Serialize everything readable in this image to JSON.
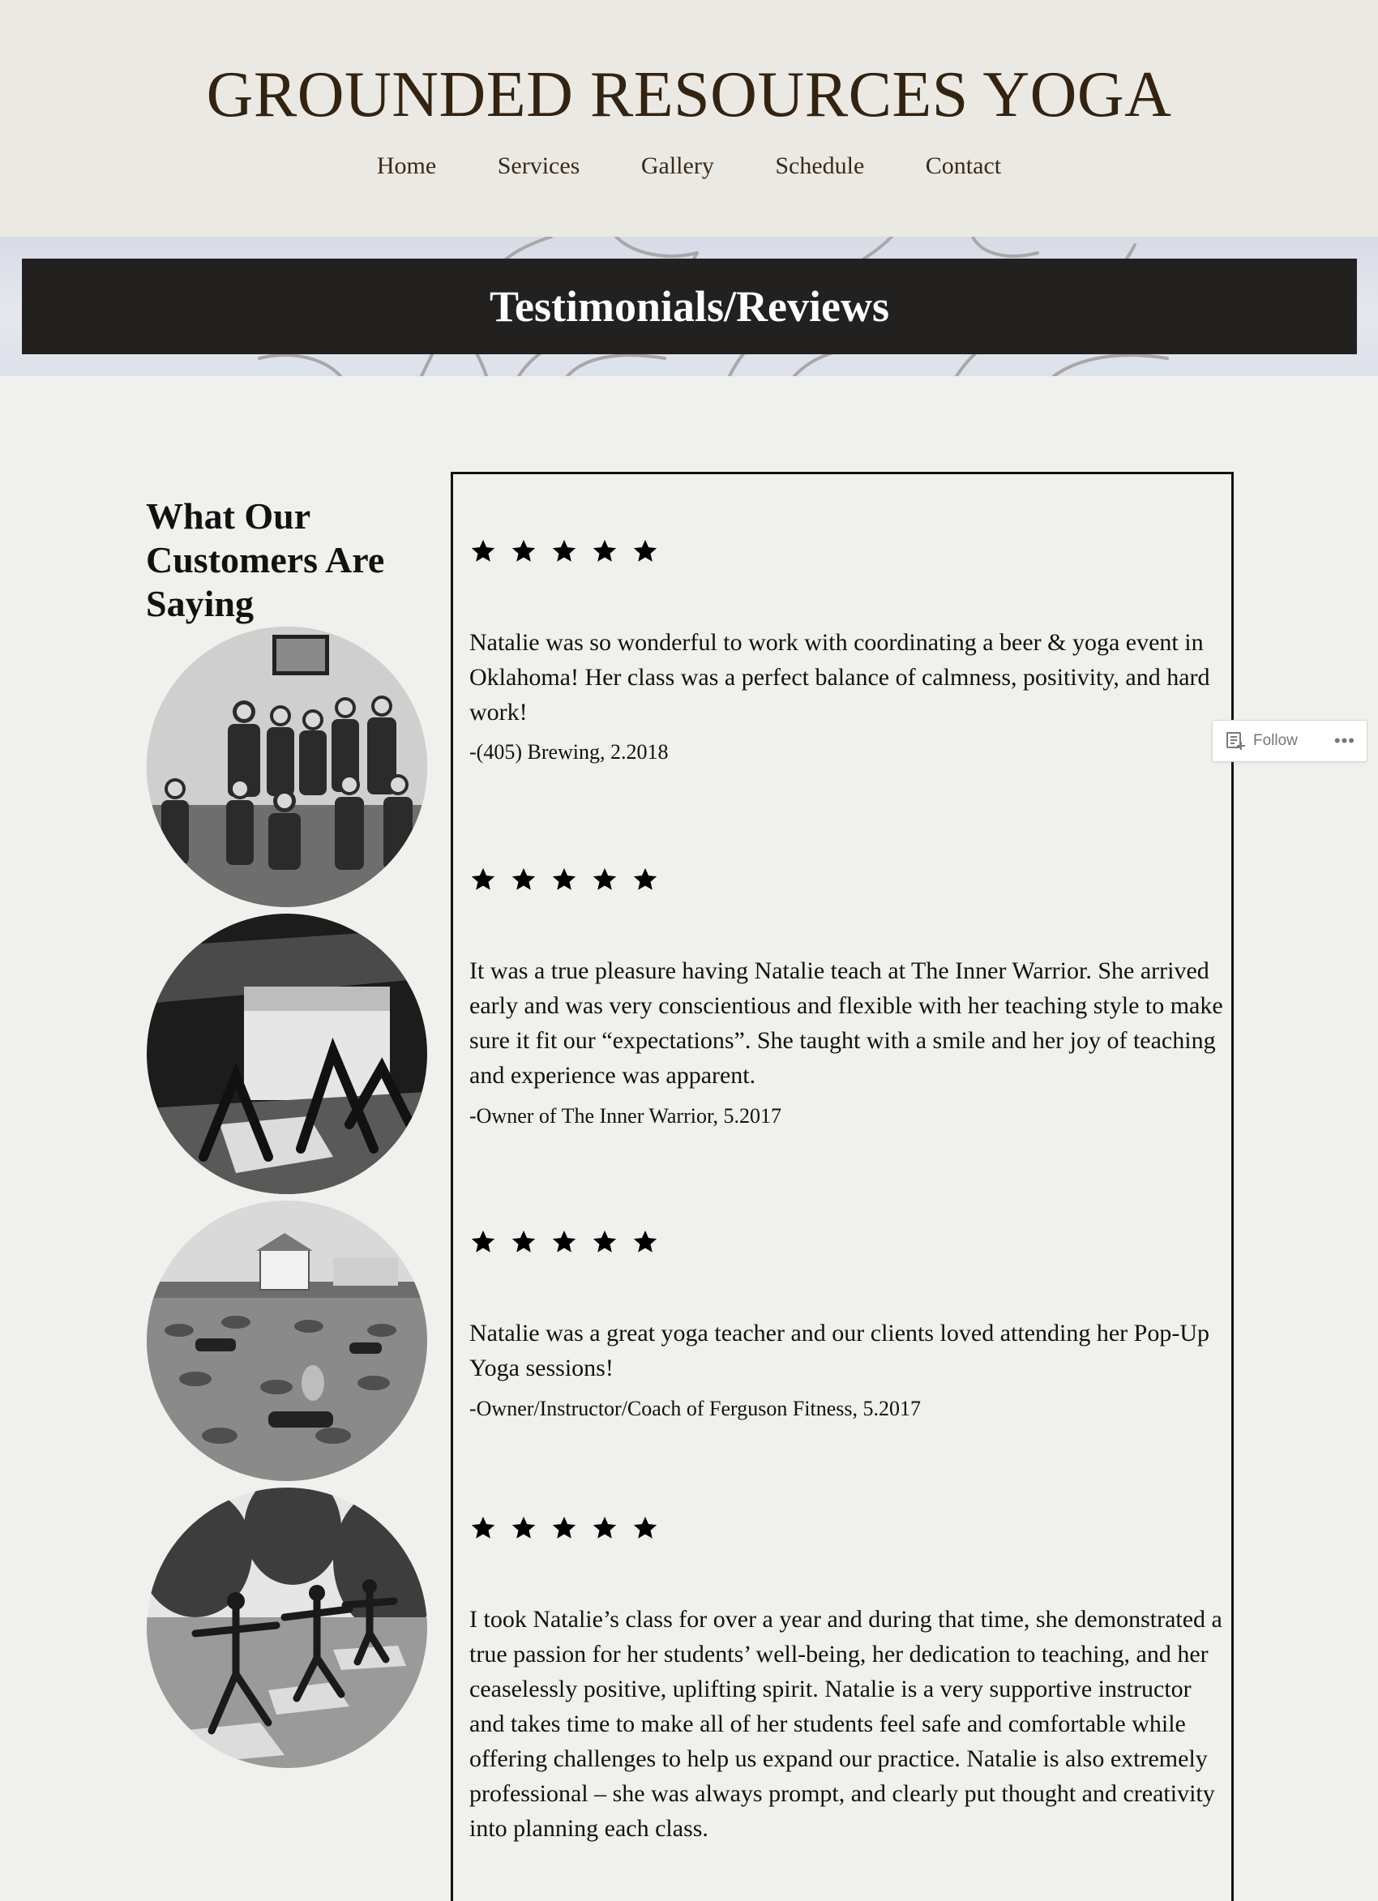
{
  "site": {
    "title": "GROUNDED RESOURCES YOGA"
  },
  "nav": {
    "items": [
      {
        "label": "Home"
      },
      {
        "label": "Services"
      },
      {
        "label": "Gallery"
      },
      {
        "label": "Schedule"
      },
      {
        "label": "Contact"
      }
    ]
  },
  "hero": {
    "title": "Testimonials/Reviews"
  },
  "sidebar": {
    "heading": "What Our Customers Are Saying",
    "photos": [
      {
        "name": "group-photo"
      },
      {
        "name": "studio-class-photo"
      },
      {
        "name": "lavender-field-class-photo"
      },
      {
        "name": "outdoor-warrior-pose-photo"
      }
    ]
  },
  "reviews": [
    {
      "rating": 5,
      "text": "Natalie was so wonderful to work with coordinating a beer & yoga event in Oklahoma! Her class was a perfect balance of calmness, positivity, and hard work!",
      "author": "-(405) Brewing, 2.2018"
    },
    {
      "rating": 5,
      "text": "It was a true pleasure having Natalie teach at The Inner Warrior. She arrived early and was very conscientious and flexible with her teaching style to make sure it fit our “expectations”. She taught with a smile and her joy of teaching and experience was apparent.",
      "author": "-Owner of The Inner Warrior, 5.2017"
    },
    {
      "rating": 5,
      "text": "Natalie was a great yoga teacher and our clients loved attending her Pop-Up Yoga sessions!",
      "author": "-Owner/Instructor/Coach of Ferguson Fitness, 5.2017"
    },
    {
      "rating": 5,
      "text": "I took Natalie’s class for over a year and during that time, she demonstrated a true passion for her students’ well-being, her dedication to teaching, and her ceaselessly positive, uplifting spirit. Natalie is a very supportive instructor and takes time to make all of her students feel safe and comfortable while offering challenges to help us expand our practice. Natalie is also extremely professional – she was always prompt, and clearly put thought and creativity into planning each class.",
      "author": ""
    }
  ],
  "follow_widget": {
    "label": "Follow",
    "more_icon": "ellipsis-icon"
  },
  "colors": {
    "header_bg": "#ebe9e4",
    "page_bg": "#f0f0ec",
    "title_color": "#33230f",
    "banner_bg": "#232120",
    "banner_text": "#ffffff"
  }
}
